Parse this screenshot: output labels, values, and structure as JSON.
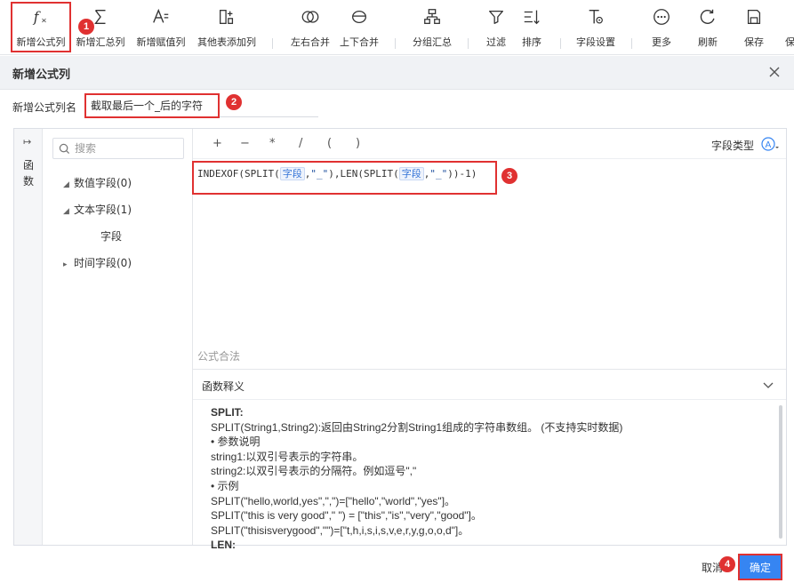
{
  "toolbar": {
    "items": [
      {
        "label": "新增公式列",
        "icon": "formula-icon"
      },
      {
        "label": "新增汇总列",
        "icon": "sigma-icon"
      },
      {
        "label": "新增赋值列",
        "icon": "assign-icon"
      },
      {
        "label": "其他表添加列",
        "icon": "add-column-icon"
      },
      {
        "label": "左右合并",
        "icon": "merge-horizontal-icon"
      },
      {
        "label": "上下合并",
        "icon": "merge-vertical-icon"
      },
      {
        "label": "分组汇总",
        "icon": "group-icon"
      },
      {
        "label": "过滤",
        "icon": "filter-icon"
      },
      {
        "label": "排序",
        "icon": "sort-icon"
      },
      {
        "label": "字段设置",
        "icon": "field-settings-icon"
      },
      {
        "label": "更多",
        "icon": "more-icon"
      },
      {
        "label": "刷新",
        "icon": "refresh-icon"
      },
      {
        "label": "保存",
        "icon": "save-icon"
      },
      {
        "label": "保",
        "icon": "preview-icon"
      }
    ]
  },
  "dialog": {
    "title": "新增公式列",
    "name_label": "新增公式列名",
    "name_value": "截取最后一个_后的字符"
  },
  "sidebar": {
    "tab_label": "函数"
  },
  "fields": {
    "search_placeholder": "搜索",
    "tree": [
      {
        "label": "数值字段(0)",
        "expanded": true
      },
      {
        "label": "文本字段(1)",
        "expanded": true
      },
      {
        "label": "字段",
        "child": true
      },
      {
        "label": "时间字段(0)",
        "expanded": false
      }
    ]
  },
  "editor": {
    "operators": [
      "+",
      "−",
      "*",
      "/",
      "(",
      ")"
    ],
    "field_type_label": "字段类型",
    "formula": {
      "p1": "INDEXOF(SPLIT(",
      "f1": "字段",
      "p2": ",",
      "s1": "\"_\"",
      "p3": "),LEN(SPLIT(",
      "f2": "字段",
      "p4": ",",
      "s2": "\"_\"",
      "p5": "))-1)"
    },
    "validation_label": "公式合法"
  },
  "help": {
    "title": "函数释义",
    "lines": [
      {
        "text": "SPLIT:",
        "bold": true
      },
      {
        "text": "SPLIT(String1,String2):返回由String2分割String1组成的字符串数组。 (不支持实时数据)",
        "bold": false
      },
      {
        "text": "• 参数说明",
        "bold": false
      },
      {
        "text": "string1:以双引号表示的字符串。",
        "bold": false
      },
      {
        "text": "string2:以双引号表示的分隔符。例如逗号\",\"",
        "bold": false
      },
      {
        "text": "• 示例",
        "bold": false
      },
      {
        "text": "SPLIT(\"hello,world,yes\",\",\")=[\"hello\",\"world\",\"yes\"]。",
        "bold": false
      },
      {
        "text": "SPLIT(\"this is very good\",\" \") = [\"this\",\"is\",\"very\",\"good\"]。",
        "bold": false
      },
      {
        "text": "SPLIT(\"thisisverygood\",\"\")=[\"t,h,i,s,i,s,v,e,r,y,g,o,o,d\"]。",
        "bold": false
      },
      {
        "text": "LEN:",
        "bold": true
      }
    ]
  },
  "footer": {
    "cancel_label": "取消",
    "ok_label": "确定"
  },
  "annotations": {
    "badge1": "1",
    "badge2": "2",
    "badge3": "3",
    "badge4": "4"
  },
  "colors": {
    "accent": "#3685f2",
    "annotation": "#e03131"
  }
}
